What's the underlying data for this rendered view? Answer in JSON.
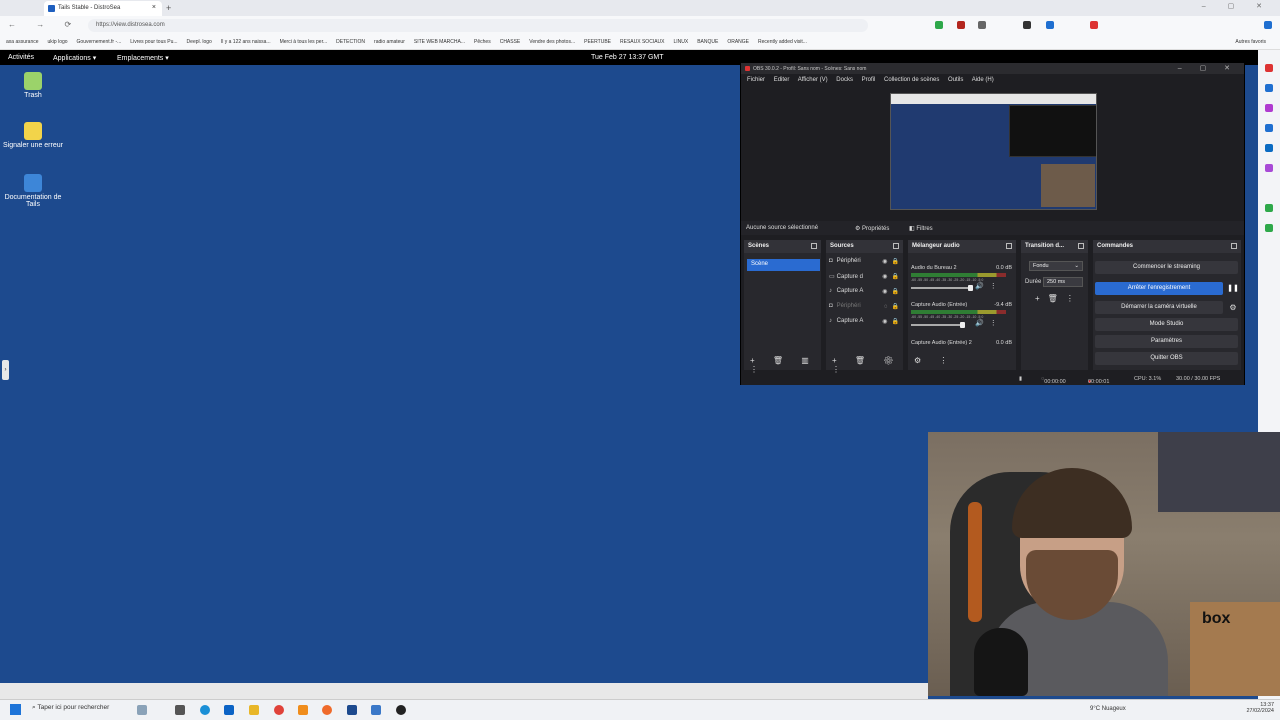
{
  "browser": {
    "tab_title": "Tails Stable - DistroSea",
    "url": "https://view.distrosea.com",
    "bookmarks": [
      "axa assurance",
      "ukip logo",
      "Gouvernement.fr -...",
      "Livres pour tous Pu...",
      "Deepl. logo",
      "Il y a 122 ans naissa...",
      "Merci à tous les per...",
      "DETECTION",
      "radio amateur",
      "SITE WEB MARCHA...",
      "Pêches",
      "CHASSE",
      "Vendre des photos...",
      "PEERTUBE",
      "RESAUX SOCIAUX",
      "LINUX",
      "BANQUE",
      "ORANGE",
      "Recently added visit..."
    ],
    "all_bookmarks": "Autres favoris"
  },
  "gnome": {
    "activities": "Activités",
    "applications": "Applications",
    "places": "Emplacements",
    "clock": "Tue Feb 27  13:37 GMT"
  },
  "desktop": {
    "icons": [
      {
        "label": "Trash",
        "color": "#9bd36a"
      },
      {
        "label": "Signaler une erreur",
        "color": "#f2d44a"
      },
      {
        "label": "Documentation de Tails",
        "color": "#3d86d8"
      }
    ]
  },
  "obs": {
    "title": "OBS 30.0.2 - Profil: Sans nom - Scènes: Sans nom",
    "menu": [
      "Fichier",
      "Editer",
      "Afficher (V)",
      "Docks",
      "Profil",
      "Collection de scènes",
      "Outils",
      "Aide (H)"
    ],
    "no_source": "Aucune source sélectionné",
    "properties": "Propriétés",
    "filters": "Filtres",
    "scenes_title": "Scènes",
    "scene_selected": "Scène",
    "sources_title": "Sources",
    "sources": [
      {
        "icon": "camera",
        "label": "Périphéri"
      },
      {
        "icon": "monitor",
        "label": "Capture d"
      },
      {
        "icon": "mic",
        "label": "Capture A"
      },
      {
        "icon": "camera",
        "label": "Périphéri",
        "disabled": true
      },
      {
        "icon": "mic",
        "label": "Capture A"
      }
    ],
    "mixer_title": "Mélangeur audio",
    "mixer": [
      {
        "name": "Audio du Bureau 2",
        "db": "0.0 dB"
      },
      {
        "name": "Capture Audio (Entrée)",
        "db": "-9.4 dB"
      },
      {
        "name": "Capture Audio (Entrée) 2",
        "db": "0.0 dB"
      }
    ],
    "meter_scale": "-60 -55 -50 -45 -40 -35 -30 -25 -20 -15 -10 -5 0",
    "transitions_title": "Transition d...",
    "transition_value": "Fondu",
    "duration_label": "Durée",
    "duration_value": "250 ms",
    "controls_title": "Commandes",
    "controls": {
      "start_stream": "Commencer le streaming",
      "stop_recording": "Arrêter l'enregistrement",
      "virtual_cam": "Démarrer la caméra virtuelle",
      "studio_mode": "Mode Studio",
      "settings": "Paramètres",
      "quit": "Quitter OBS"
    },
    "status": {
      "stream_time": "00:00:00",
      "rec_time": "00:00:01",
      "cpu": "CPU: 3.1%",
      "fps": "30.00 / 30.00 FPS"
    }
  },
  "webcam": {
    "box_text": "box"
  },
  "taskbar": {
    "search_placeholder": "Taper ici pour rechercher",
    "weather": "9°C  Nuageux",
    "time": "13:37",
    "date": "27/02/2024"
  }
}
